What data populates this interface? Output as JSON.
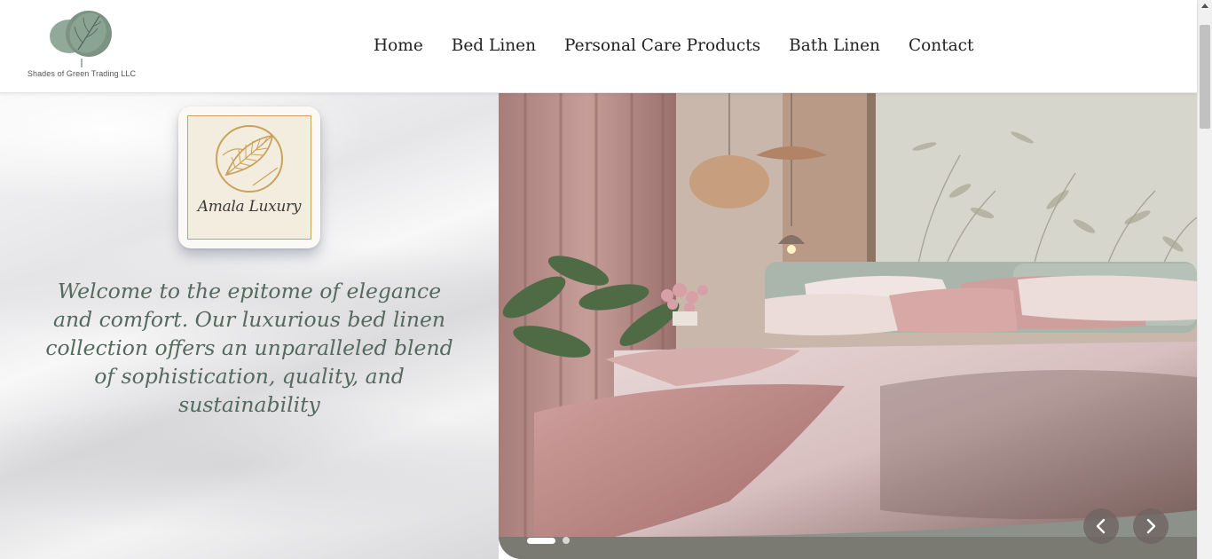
{
  "header": {
    "company_name": "Shades of Green Trading LLC",
    "nav": [
      {
        "label": "Home"
      },
      {
        "label": "Bed Linen"
      },
      {
        "label": "Personal Care Products"
      },
      {
        "label": "Bath Linen"
      },
      {
        "label": "Contact"
      }
    ]
  },
  "hero": {
    "brand_logo_text": "Amala Luxury",
    "tagline": "Welcome to the epitome of elegance and comfort. Our luxurious bed linen collection offers an unparalleled blend of sophistication, quality, and sustainability"
  },
  "slider": {
    "slide_count": 2,
    "active_slide": 1,
    "prev_icon": "chevron-left-icon",
    "next_icon": "chevron-right-icon"
  },
  "colors": {
    "tagline": "#55695e",
    "logo_green": "#7e9a86",
    "gold": "#c9a35c"
  }
}
